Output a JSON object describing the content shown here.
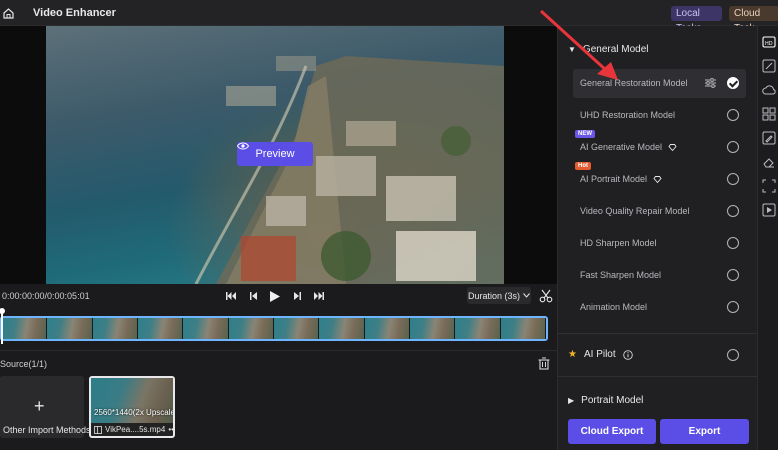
{
  "titlebar": {
    "title": "Video Enhancer",
    "local_tasks": "Local Tasks",
    "cloud_task": "Cloud Task"
  },
  "preview": {
    "button_label": "Preview"
  },
  "transport": {
    "timecode": "0:00:00:00/0:00:05:01",
    "duration_label": "Duration (3s)"
  },
  "source": {
    "label": "Source(1/1)",
    "import_label": "Other Import Methods",
    "clip_resolution": "2560*1440(2x Upscale)",
    "clip_name": "VikPea....5s.mp4"
  },
  "panel": {
    "general_heading": "General Model",
    "models": [
      {
        "label": "General Restoration Model",
        "selected": true
      },
      {
        "label": "UHD Restoration Model",
        "selected": false
      },
      {
        "label": "AI Generative Model",
        "badge": "NEW",
        "selected": false
      },
      {
        "label": "AI Portrait Model",
        "badge": "Hot",
        "selected": false
      },
      {
        "label": "Video Quality Repair Model",
        "selected": false
      },
      {
        "label": "HD Sharpen Model",
        "selected": false
      },
      {
        "label": "Fast Sharpen Model",
        "selected": false
      },
      {
        "label": "Animation Model",
        "selected": false
      }
    ],
    "ai_pilot": "AI Pilot",
    "portrait_heading": "Portrait Model",
    "cloud_export": "Cloud Export",
    "export": "Export"
  },
  "colors": {
    "accent": "#5b4ee6",
    "annotation": "#e8343b",
    "background": "#1b1b1d"
  }
}
